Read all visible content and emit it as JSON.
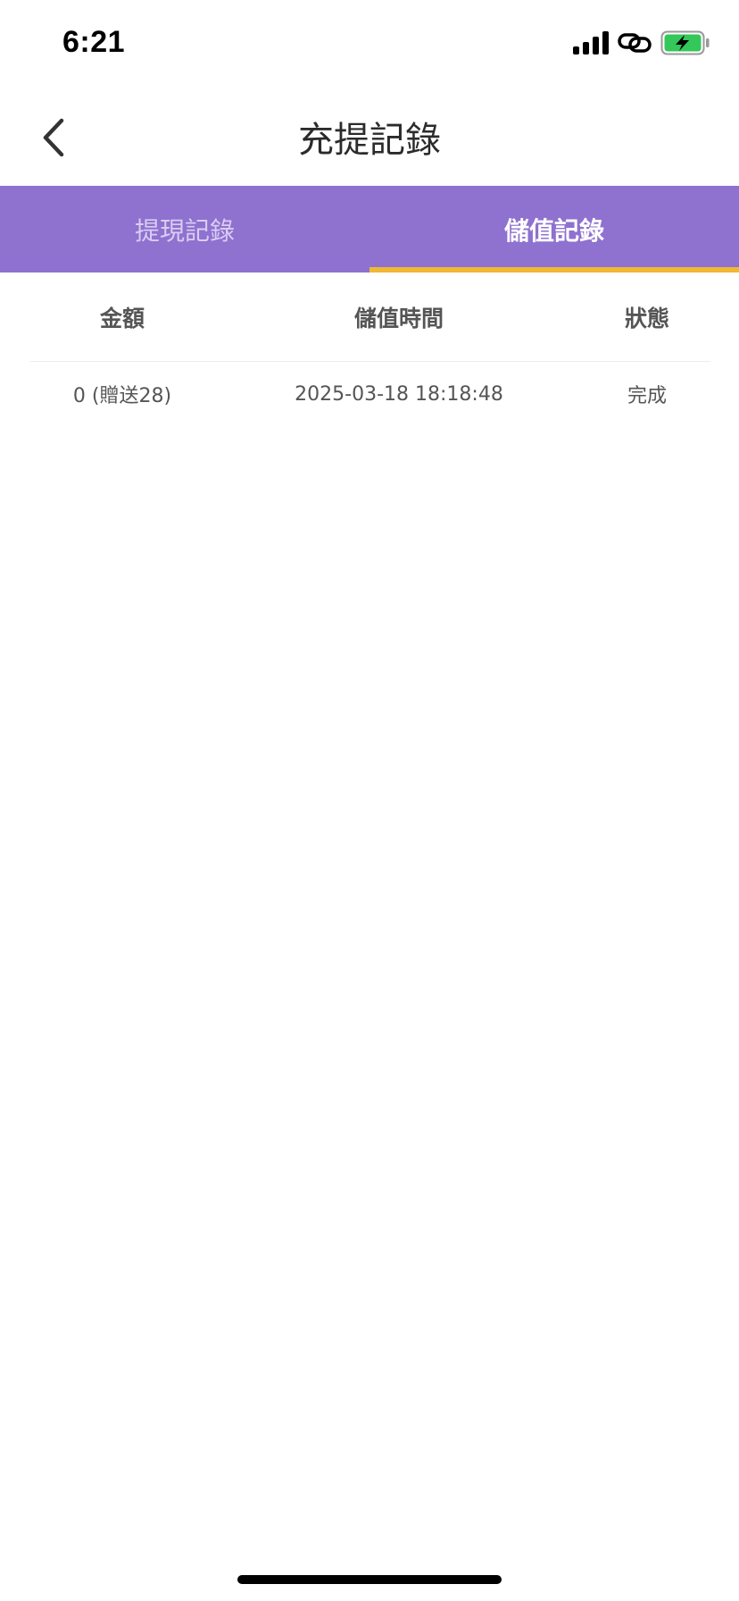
{
  "status_bar": {
    "time": "6:21",
    "icons": [
      "cellular-signal-icon",
      "link-icon",
      "battery-charging-icon"
    ],
    "battery_color": "#34c759"
  },
  "nav": {
    "title": "充提記錄",
    "back_icon": "chevron-left-icon"
  },
  "tabs": [
    {
      "label": "提現記錄",
      "active": false
    },
    {
      "label": "儲值記錄",
      "active": true
    }
  ],
  "colors": {
    "tab_bar": "#8f71cf",
    "tab_indicator": "#f0b833"
  },
  "table": {
    "columns": [
      "金額",
      "儲值時間",
      "狀態"
    ],
    "rows": [
      {
        "amount": "0 (贈送28)",
        "time": "2025-03-18 18:18:48",
        "status": "完成"
      }
    ]
  }
}
